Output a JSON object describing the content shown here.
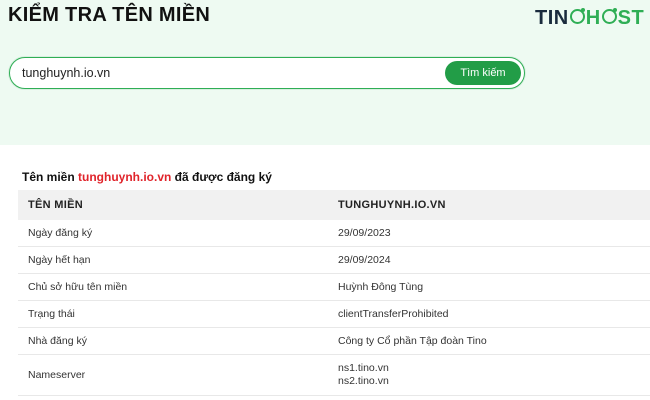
{
  "header": {
    "title": "KIỂM TRA TÊN MIỀN",
    "logo": {
      "part1": "TIN",
      "part2": "H",
      "part3": "ST"
    }
  },
  "search": {
    "value": "tunghuynh.io.vn",
    "button_label": "Tìm kiếm"
  },
  "result": {
    "prefix": "Tên miền ",
    "domain": "tunghuynh.io.vn",
    "suffix": " đã được đăng ký"
  },
  "table": {
    "header_label": "TÊN MIỀN",
    "header_value": "TUNGHUYNH.IO.VN",
    "rows": [
      {
        "label": "Ngày đăng ký",
        "value": "29/09/2023"
      },
      {
        "label": "Ngày hết hạn",
        "value": "29/09/2024"
      },
      {
        "label": "Chủ sở hữu tên miền",
        "value": "Huỳnh Đông Tùng"
      },
      {
        "label": "Trạng thái",
        "value": "clientTransferProhibited"
      },
      {
        "label": "Nhà đăng ký",
        "value": "Công ty Cổ phần Tập đoàn Tino"
      }
    ],
    "nameserver_label": "Nameserver",
    "nameservers": [
      "ns1.tino.vn",
      "ns2.tino.vn"
    ]
  },
  "colors": {
    "accent": "#229d47",
    "highlight": "#e0242b",
    "hero_bg": "#eefaf2"
  }
}
